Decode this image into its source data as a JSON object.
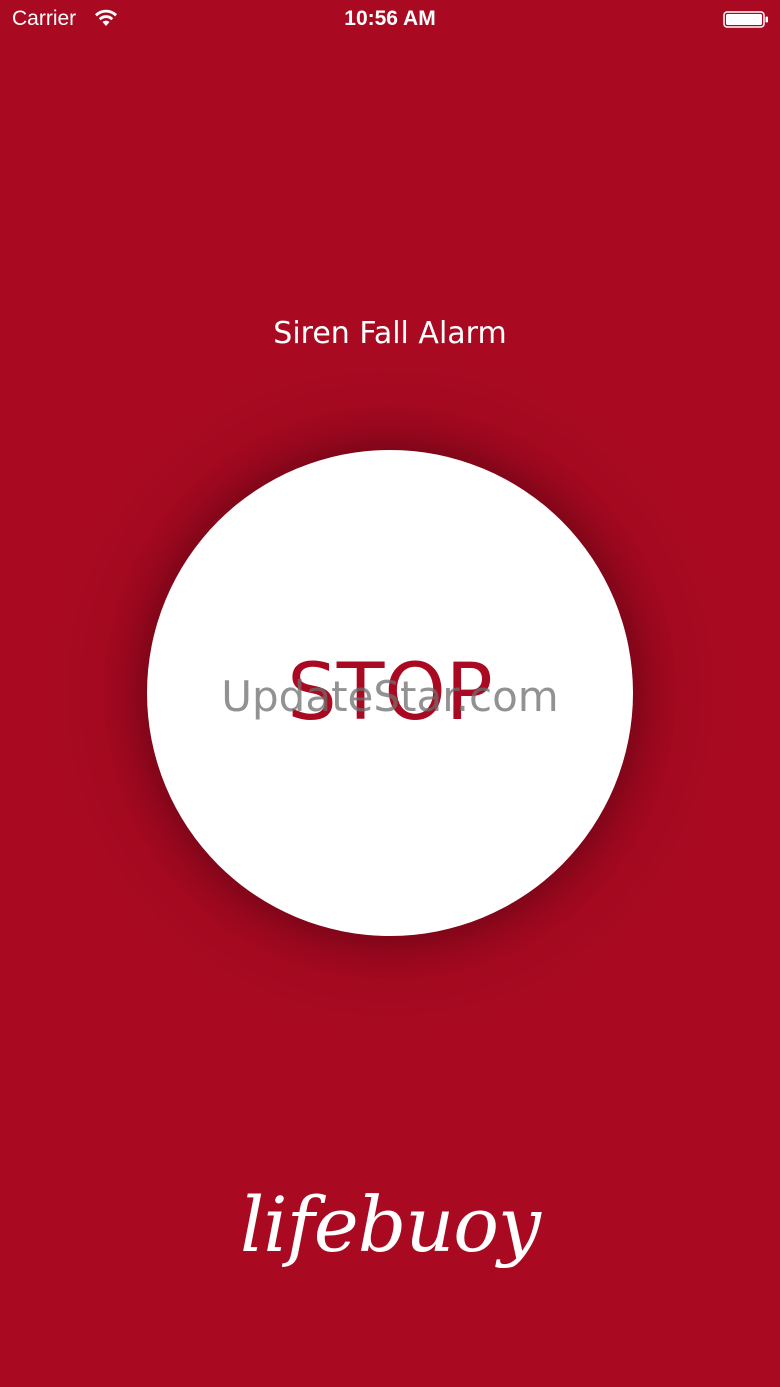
{
  "status_bar": {
    "carrier": "Carrier",
    "time": "10:56 AM",
    "wifi_icon": "wifi-icon",
    "battery_icon": "battery-icon"
  },
  "screen": {
    "title": "Siren Fall Alarm",
    "stop_label": "STOP",
    "watermark": "UpdateStar.com",
    "logo": "lifebuoy"
  },
  "colors": {
    "background": "#a90a22",
    "button": "#ffffff",
    "accent_text": "#a90a22"
  }
}
